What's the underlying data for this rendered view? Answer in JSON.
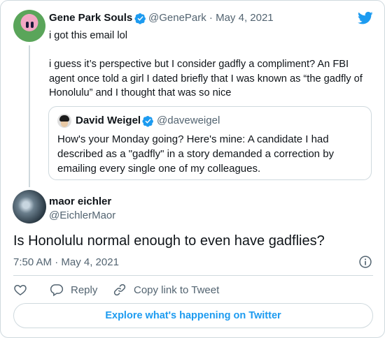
{
  "colors": {
    "accent": "#1d9bf0",
    "secondary_text": "#536471",
    "border": "#cfd9de"
  },
  "parent_tweet": {
    "author_name": "Gene Park Souls",
    "meta": "@GenePark · May 4, 2021",
    "text": "i got this email lol\n\ni guess it’s perspective but I consider gadfly a compliment? An FBI agent once told a girl I dated briefly that I was known as “the gadfly of Honolulu” and I thought that was so nice",
    "quoted": {
      "author_name": "David Weigel",
      "handle": "@daveweigel",
      "text": "How's your Monday going? Here's mine: A candidate I had described as a \"gadfly\" in a story demanded a correction by emailing every single one of my colleagues."
    }
  },
  "main_tweet": {
    "author_name": "maor eichler",
    "handle": "@EichlerMaor",
    "text": "Is Honolulu normal enough to even have gadflies?",
    "timestamp": "7:50 AM · May 4, 2021"
  },
  "actions": {
    "reply_label": "Reply",
    "copy_link_label": "Copy link to Tweet",
    "explore_label": "Explore what's happening on Twitter"
  },
  "icons": [
    "twitter-logo-icon",
    "verified-badge-icon",
    "info-icon",
    "heart-icon",
    "reply-icon",
    "link-icon"
  ]
}
